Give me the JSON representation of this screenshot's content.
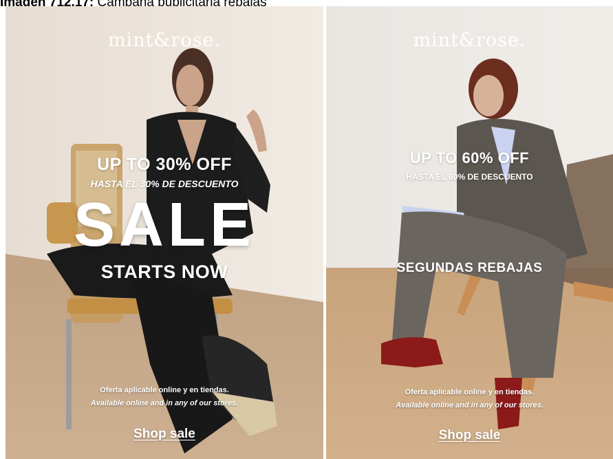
{
  "caption": {
    "label": "Imagen 712.17:",
    "text": "Campaña publicitaria rebajas"
  },
  "colors": {
    "overlay_text": "#ffffff",
    "left_backdrop": "#ece6de",
    "left_floor": "#c7a98a",
    "right_backdrop": "#ebe7e2",
    "right_floor": "#caa883",
    "suit_black": "#1c1c1c",
    "suit_grey": "#5f5a55",
    "red_boots": "#8c1a1a",
    "shirt_blue": "#c9d3ef"
  },
  "left_ad": {
    "brand": "mint&rose.",
    "headline": "UP TO 30% OFF",
    "subline": "HASTA EL 30% DE DESCUENTO",
    "big_word": "SALE",
    "cta_text": "STARTS NOW",
    "note_es": "Oferta aplicable online y en tiendas.",
    "note_en": "Available online and in any of our stores.",
    "shop_link": "Shop sale"
  },
  "right_ad": {
    "brand": "mint&rose.",
    "headline": "UP TO 60% OFF",
    "subline": "HASTA EL 60% DE DESCUENTO",
    "cta_text": "SEGUNDAS REBAJAS",
    "note_es": "Oferta aplicable online y en tiendas.",
    "note_en": "Available online and in any of our stores.",
    "shop_link": "Shop sale"
  }
}
